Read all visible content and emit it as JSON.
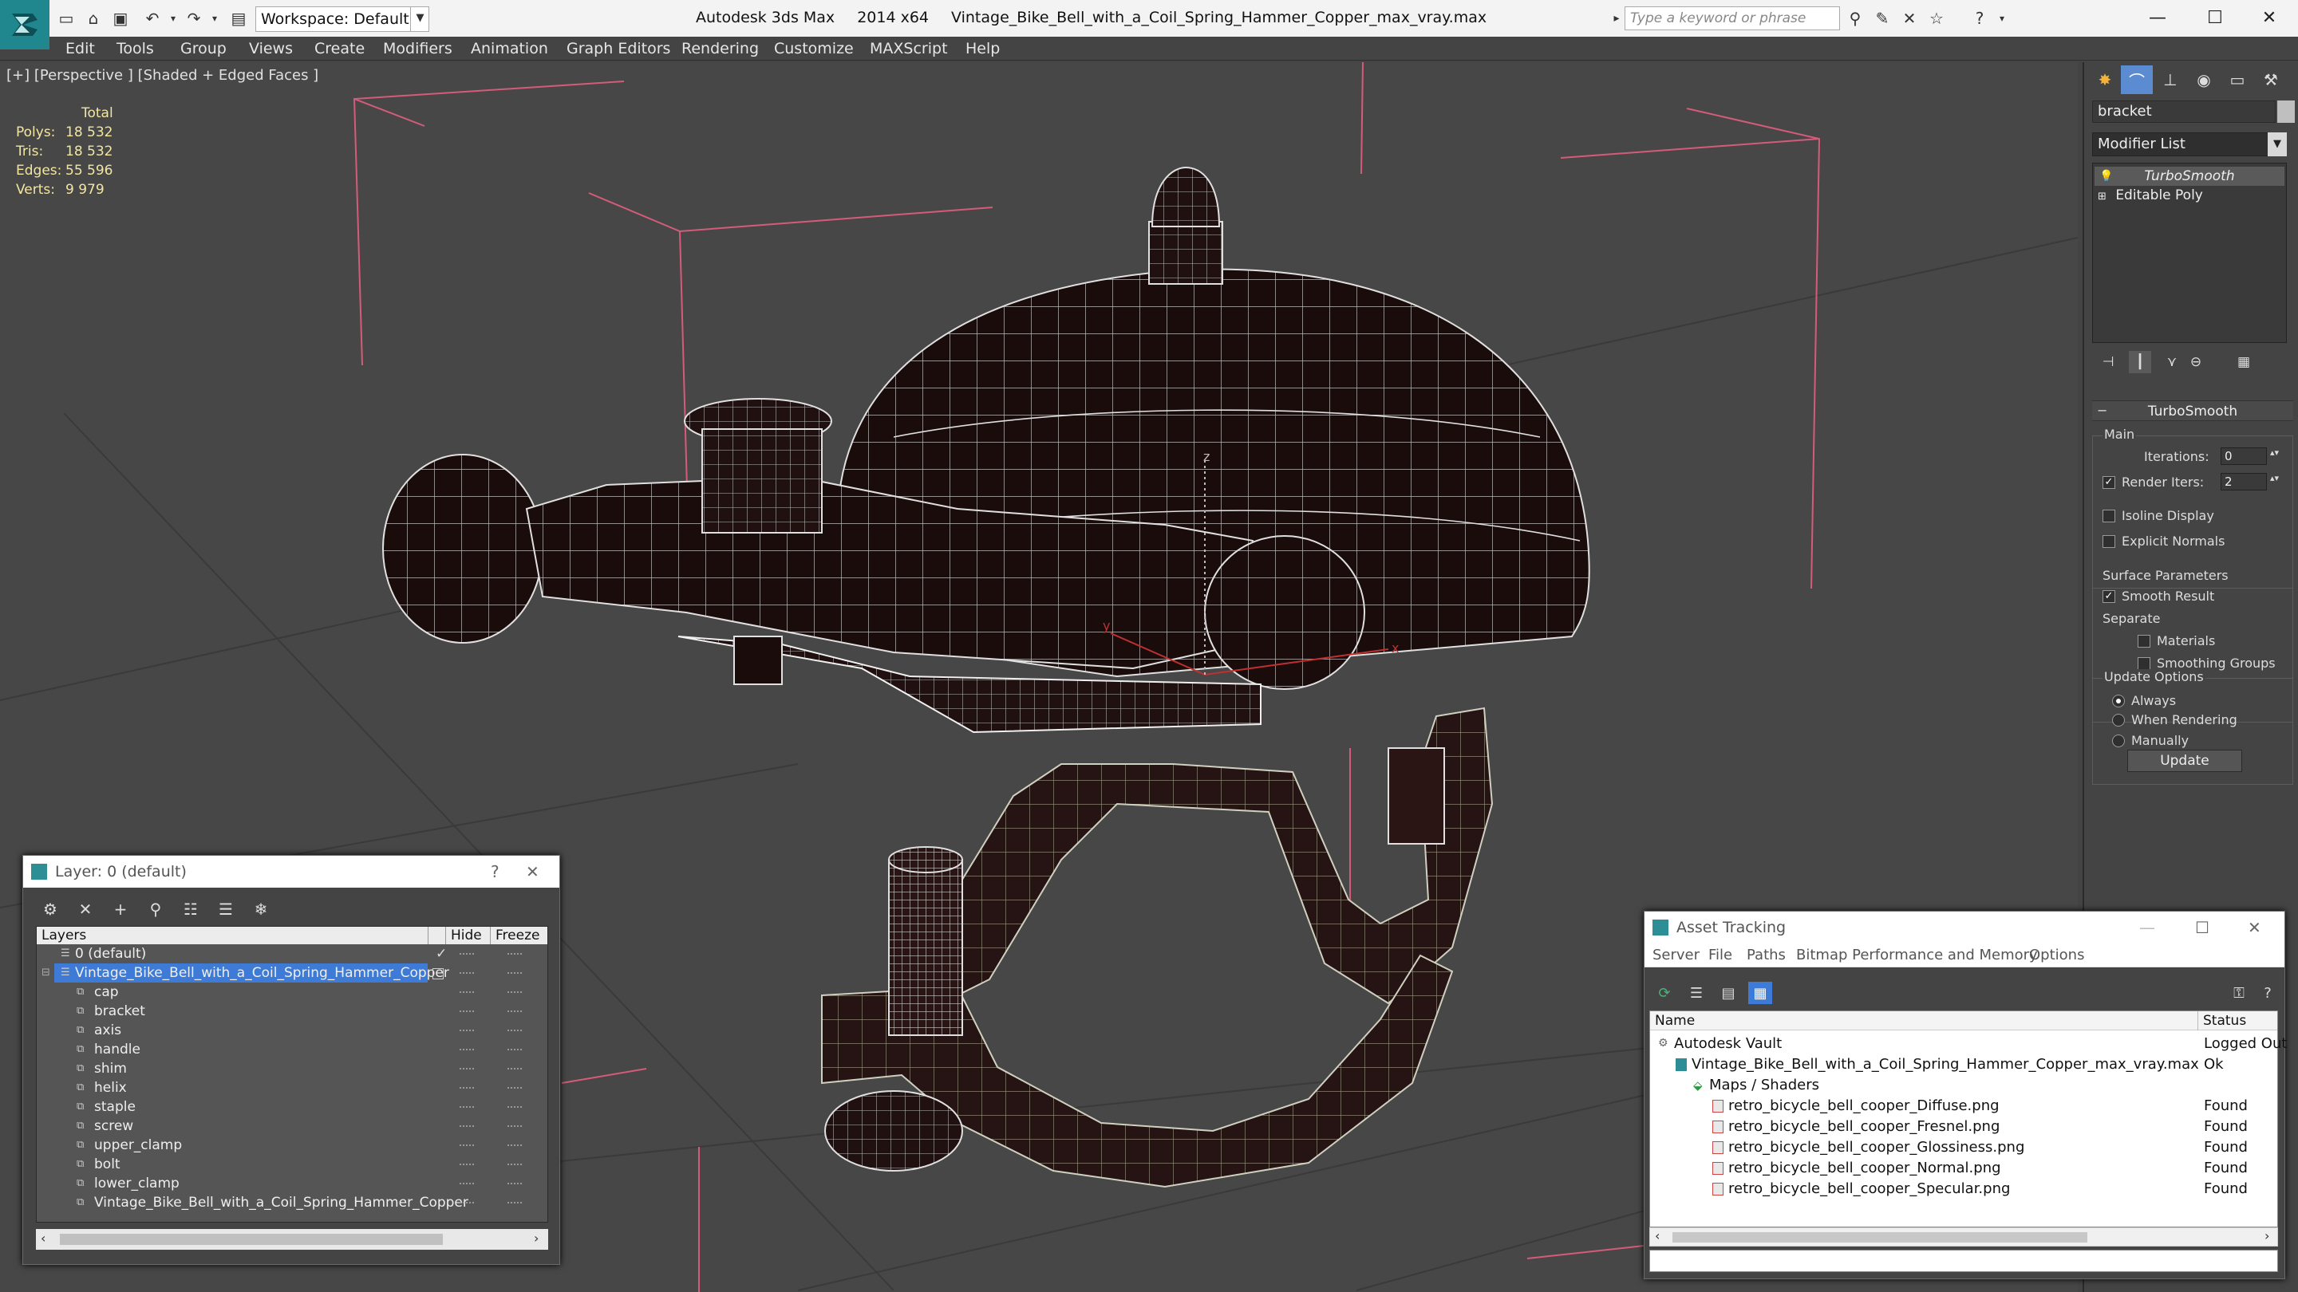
{
  "titlebar": {
    "workspace": "Workspace: Default",
    "app_name": "Autodesk 3ds Max",
    "version": "2014 x64",
    "filename": "Vintage_Bike_Bell_with_a_Coil_Spring_Hammer_Copper_max_vray.max",
    "search_placeholder": "Type a keyword or phrase"
  },
  "menu": {
    "items": [
      "Edit",
      "Tools",
      "Group",
      "Views",
      "Create",
      "Modifiers",
      "Animation",
      "Graph Editors",
      "Rendering",
      "Customize",
      "MAXScript",
      "Help"
    ]
  },
  "viewport": {
    "label": "[+] [Perspective ] [Shaded + Edged Faces ]",
    "stats": {
      "header": "Total",
      "rows": [
        {
          "key": "Polys:",
          "value": "18 532"
        },
        {
          "key": "Tris:",
          "value": "18 532"
        },
        {
          "key": "Edges:",
          "value": "55 596"
        },
        {
          "key": "Verts:",
          "value": "9 979"
        }
      ]
    },
    "axis_labels": {
      "y": "y",
      "x": "x",
      "z": "z"
    }
  },
  "command_panel": {
    "object_name": "bracket",
    "modifier_list": "Modifier List",
    "stack": [
      "TurboSmooth",
      "Editable Poly"
    ],
    "rollout_title": "TurboSmooth",
    "main": {
      "title": "Main",
      "iterations_label": "Iterations:",
      "iterations_value": "0",
      "render_iters_label": "Render Iters:",
      "render_iters_value": "2",
      "isoline": "Isoline Display",
      "explicit_normals": "Explicit Normals"
    },
    "surface": {
      "title": "Surface Parameters",
      "smooth_result": "Smooth Result",
      "separate": "Separate",
      "materials": "Materials",
      "smoothing_groups": "Smoothing Groups"
    },
    "update_options": {
      "title": "Update Options",
      "always": "Always",
      "when_rendering": "When Rendering",
      "manually": "Manually",
      "update_button": "Update"
    }
  },
  "layer_dialog": {
    "title": "Layer: 0 (default)",
    "help": "?",
    "columns": [
      "Layers",
      "Hide",
      "Freeze"
    ],
    "rows": [
      {
        "name": "0 (default)",
        "indent": 1,
        "selected": false
      },
      {
        "name": "Vintage_Bike_Bell_with_a_Coil_Spring_Hammer_Copper",
        "indent": 1,
        "selected": true
      },
      {
        "name": "cap",
        "indent": 2,
        "selected": false
      },
      {
        "name": "bracket",
        "indent": 2,
        "selected": false
      },
      {
        "name": "axis",
        "indent": 2,
        "selected": false
      },
      {
        "name": "handle",
        "indent": 2,
        "selected": false
      },
      {
        "name": "shim",
        "indent": 2,
        "selected": false
      },
      {
        "name": "helix",
        "indent": 2,
        "selected": false
      },
      {
        "name": "staple",
        "indent": 2,
        "selected": false
      },
      {
        "name": "screw",
        "indent": 2,
        "selected": false
      },
      {
        "name": "upper_clamp",
        "indent": 2,
        "selected": false
      },
      {
        "name": "bolt",
        "indent": 2,
        "selected": false
      },
      {
        "name": "lower_clamp",
        "indent": 2,
        "selected": false
      },
      {
        "name": "Vintage_Bike_Bell_with_a_Coil_Spring_Hammer_Copper",
        "indent": 2,
        "selected": false
      }
    ]
  },
  "asset_tracking": {
    "title": "Asset Tracking",
    "menu": [
      "Server",
      "File",
      "Paths",
      "Bitmap Performance and Memory",
      "Options"
    ],
    "columns": [
      "Name",
      "Status"
    ],
    "rows": [
      {
        "name": "Autodesk Vault",
        "status": "Logged Out",
        "indent": 1
      },
      {
        "name": "Vintage_Bike_Bell_with_a_Coil_Spring_Hammer_Copper_max_vray.max",
        "status": "Ok",
        "indent": 2
      },
      {
        "name": "Maps / Shaders",
        "status": "",
        "indent": 3
      },
      {
        "name": "retro_bicycle_bell_cooper_Diffuse.png",
        "status": "Found",
        "indent": 4
      },
      {
        "name": "retro_bicycle_bell_cooper_Fresnel.png",
        "status": "Found",
        "indent": 4
      },
      {
        "name": "retro_bicycle_bell_cooper_Glossiness.png",
        "status": "Found",
        "indent": 4
      },
      {
        "name": "retro_bicycle_bell_cooper_Normal.png",
        "status": "Found",
        "indent": 4
      },
      {
        "name": "retro_bicycle_bell_cooper_Specular.png",
        "status": "Found",
        "indent": 4
      }
    ]
  },
  "colors": {
    "accent": "#2d8e96",
    "selection": "#3d7bd6",
    "mesh_dark": "#1b0c0c",
    "bbox_pink": "#d45c7a",
    "stats_yellow": "#f2e6a0"
  }
}
